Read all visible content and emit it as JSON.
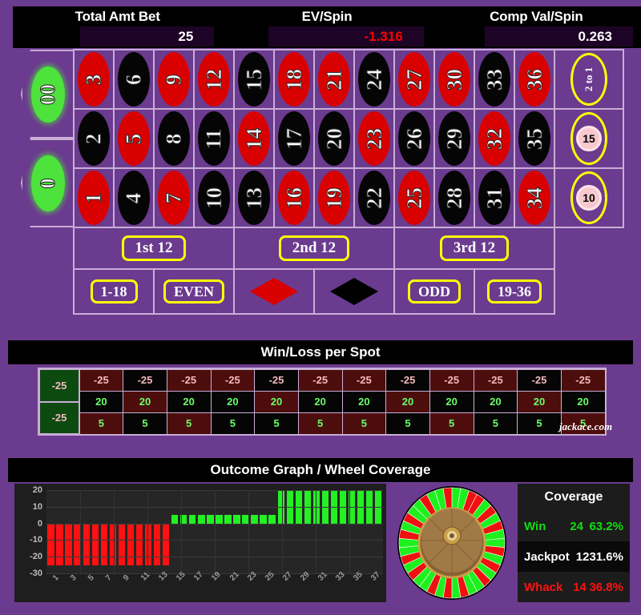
{
  "header": {
    "stats": [
      {
        "label": "Total Amt Bet",
        "value": "25",
        "negative": false
      },
      {
        "label": "EV/Spin",
        "value": "-1.316",
        "negative": true
      },
      {
        "label": "Comp Val/Spin",
        "value": "0.263",
        "negative": false
      }
    ]
  },
  "betting_table": {
    "zeros": [
      {
        "label": "00"
      },
      {
        "label": "0"
      }
    ],
    "numbers": [
      {
        "n": "3",
        "color": "red"
      },
      {
        "n": "6",
        "color": "black"
      },
      {
        "n": "9",
        "color": "red"
      },
      {
        "n": "12",
        "color": "red"
      },
      {
        "n": "15",
        "color": "black"
      },
      {
        "n": "18",
        "color": "red"
      },
      {
        "n": "21",
        "color": "red"
      },
      {
        "n": "24",
        "color": "black"
      },
      {
        "n": "27",
        "color": "red"
      },
      {
        "n": "30",
        "color": "red"
      },
      {
        "n": "33",
        "color": "black"
      },
      {
        "n": "36",
        "color": "red"
      },
      {
        "n": "2",
        "color": "black"
      },
      {
        "n": "5",
        "color": "red"
      },
      {
        "n": "8",
        "color": "black"
      },
      {
        "n": "11",
        "color": "black"
      },
      {
        "n": "14",
        "color": "red"
      },
      {
        "n": "17",
        "color": "black"
      },
      {
        "n": "20",
        "color": "black"
      },
      {
        "n": "23",
        "color": "red"
      },
      {
        "n": "26",
        "color": "black"
      },
      {
        "n": "29",
        "color": "black"
      },
      {
        "n": "32",
        "color": "red"
      },
      {
        "n": "35",
        "color": "black"
      },
      {
        "n": "1",
        "color": "red"
      },
      {
        "n": "4",
        "color": "black"
      },
      {
        "n": "7",
        "color": "red"
      },
      {
        "n": "10",
        "color": "black"
      },
      {
        "n": "13",
        "color": "black"
      },
      {
        "n": "16",
        "color": "red"
      },
      {
        "n": "19",
        "color": "red"
      },
      {
        "n": "22",
        "color": "black"
      },
      {
        "n": "25",
        "color": "red"
      },
      {
        "n": "28",
        "color": "black"
      },
      {
        "n": "31",
        "color": "black"
      },
      {
        "n": "34",
        "color": "red"
      }
    ],
    "column_bets": [
      {
        "label": "2 to 1",
        "chip": null
      },
      {
        "label": "2 to 1",
        "chip": "15"
      },
      {
        "label": "2 to 1",
        "chip": "10"
      }
    ],
    "dozens": [
      {
        "label": "1st 12"
      },
      {
        "label": "2nd 12"
      },
      {
        "label": "3rd 12"
      }
    ],
    "outside": [
      {
        "label": "1-18",
        "kind": "pill"
      },
      {
        "label": "EVEN",
        "kind": "pill"
      },
      {
        "label": "RED",
        "kind": "diamond-red"
      },
      {
        "label": "BLACK",
        "kind": "diamond-black"
      },
      {
        "label": "ODD",
        "kind": "pill"
      },
      {
        "label": "19-36",
        "kind": "pill"
      }
    ]
  },
  "winloss": {
    "title": "Win/Loss per Spot",
    "zero_values": [
      "-25",
      "-25"
    ],
    "rows": [
      {
        "values": [
          "-25",
          "-25",
          "-25",
          "-25",
          "-25",
          "-25",
          "-25",
          "-25",
          "-25",
          "-25",
          "-25",
          "-25"
        ],
        "colors": [
          "red",
          "black",
          "red",
          "red",
          "black",
          "red",
          "red",
          "black",
          "red",
          "red",
          "black",
          "red"
        ],
        "kind": "loss"
      },
      {
        "values": [
          "20",
          "20",
          "20",
          "20",
          "20",
          "20",
          "20",
          "20",
          "20",
          "20",
          "20",
          "20"
        ],
        "colors": [
          "black",
          "red",
          "black",
          "black",
          "red",
          "black",
          "black",
          "red",
          "black",
          "black",
          "red",
          "black"
        ],
        "kind": "win"
      },
      {
        "values": [
          "5",
          "5",
          "5",
          "5",
          "5",
          "5",
          "5",
          "5",
          "5",
          "5",
          "5",
          "5"
        ],
        "colors": [
          "red",
          "black",
          "red",
          "black",
          "black",
          "red",
          "red",
          "black",
          "red",
          "black",
          "black",
          "red"
        ],
        "kind": "win"
      }
    ],
    "watermark": "jackace.com"
  },
  "outcome": {
    "title": "Outcome Graph / Wheel Coverage",
    "coverage": {
      "title": "Coverage",
      "rows": [
        {
          "name": "Win",
          "count": "24",
          "pct": "63.2%",
          "style": "cv-win"
        },
        {
          "name": "Jackpot",
          "count": "12",
          "pct": "31.6%",
          "style": "cv-jack"
        },
        {
          "name": "Whack",
          "count": "14",
          "pct": "36.8%",
          "style": "cv-whack"
        }
      ]
    }
  },
  "chart_data": {
    "type": "bar",
    "title": "Outcome Graph / Wheel Coverage",
    "xlabel": "",
    "ylabel": "",
    "ylim": [
      -30,
      20
    ],
    "yticks": [
      20,
      10,
      0,
      -10,
      -20,
      -30
    ],
    "grid": true,
    "legend": null,
    "categories": [
      "1",
      "2",
      "3",
      "4",
      "5",
      "6",
      "7",
      "8",
      "9",
      "10",
      "11",
      "12",
      "13",
      "14",
      "15",
      "16",
      "17",
      "18",
      "19",
      "20",
      "21",
      "22",
      "23",
      "24",
      "25",
      "26",
      "27",
      "28",
      "29",
      "30",
      "31",
      "32",
      "33",
      "34",
      "35",
      "36",
      "37",
      "38"
    ],
    "xtick_labels": [
      "1",
      "3",
      "5",
      "7",
      "9",
      "11",
      "13",
      "15",
      "17",
      "19",
      "21",
      "23",
      "25",
      "27",
      "29",
      "31",
      "33",
      "35",
      "37"
    ],
    "values": [
      -25,
      -25,
      -25,
      -25,
      -25,
      -25,
      -25,
      -25,
      -25,
      -25,
      -25,
      -25,
      -25,
      -25,
      5,
      5,
      5,
      5,
      5,
      5,
      5,
      5,
      5,
      5,
      5,
      5,
      20,
      20,
      20,
      20,
      20,
      20,
      20,
      20,
      20,
      20,
      20,
      20
    ],
    "bar_colors": [
      "neg",
      "neg",
      "neg",
      "neg",
      "neg",
      "neg",
      "neg",
      "neg",
      "neg",
      "neg",
      "neg",
      "neg",
      "neg",
      "neg",
      "pos",
      "pos",
      "pos",
      "pos",
      "pos",
      "pos",
      "pos",
      "pos",
      "pos",
      "pos",
      "pos",
      "pos",
      "pos",
      "pos",
      "pos",
      "pos",
      "pos",
      "pos",
      "pos",
      "pos",
      "pos",
      "pos",
      "pos",
      "pos"
    ],
    "colors": {
      "positive": "#24f024",
      "negative": "#ff1111",
      "plot_bg": "#262626",
      "panel_bg": "#1e1e1e"
    }
  },
  "wheel": {
    "segments": [
      "green",
      "green",
      "red",
      "red",
      "green",
      "red",
      "green",
      "red",
      "green",
      "green",
      "red",
      "green",
      "red",
      "green",
      "red",
      "green",
      "green",
      "red",
      "green",
      "red",
      "green",
      "red",
      "green",
      "green",
      "red",
      "green",
      "red",
      "green",
      "green",
      "red",
      "green",
      "red",
      "green",
      "green",
      "red",
      "green",
      "green",
      "red"
    ]
  },
  "colors": {
    "background": "#6b3b8f",
    "grid_line": "#c9aed6",
    "accent_yellow": "#ffff00",
    "red": "#d90000",
    "black": "#050505",
    "green": "#4ee23c",
    "panel_black": "#000000"
  }
}
